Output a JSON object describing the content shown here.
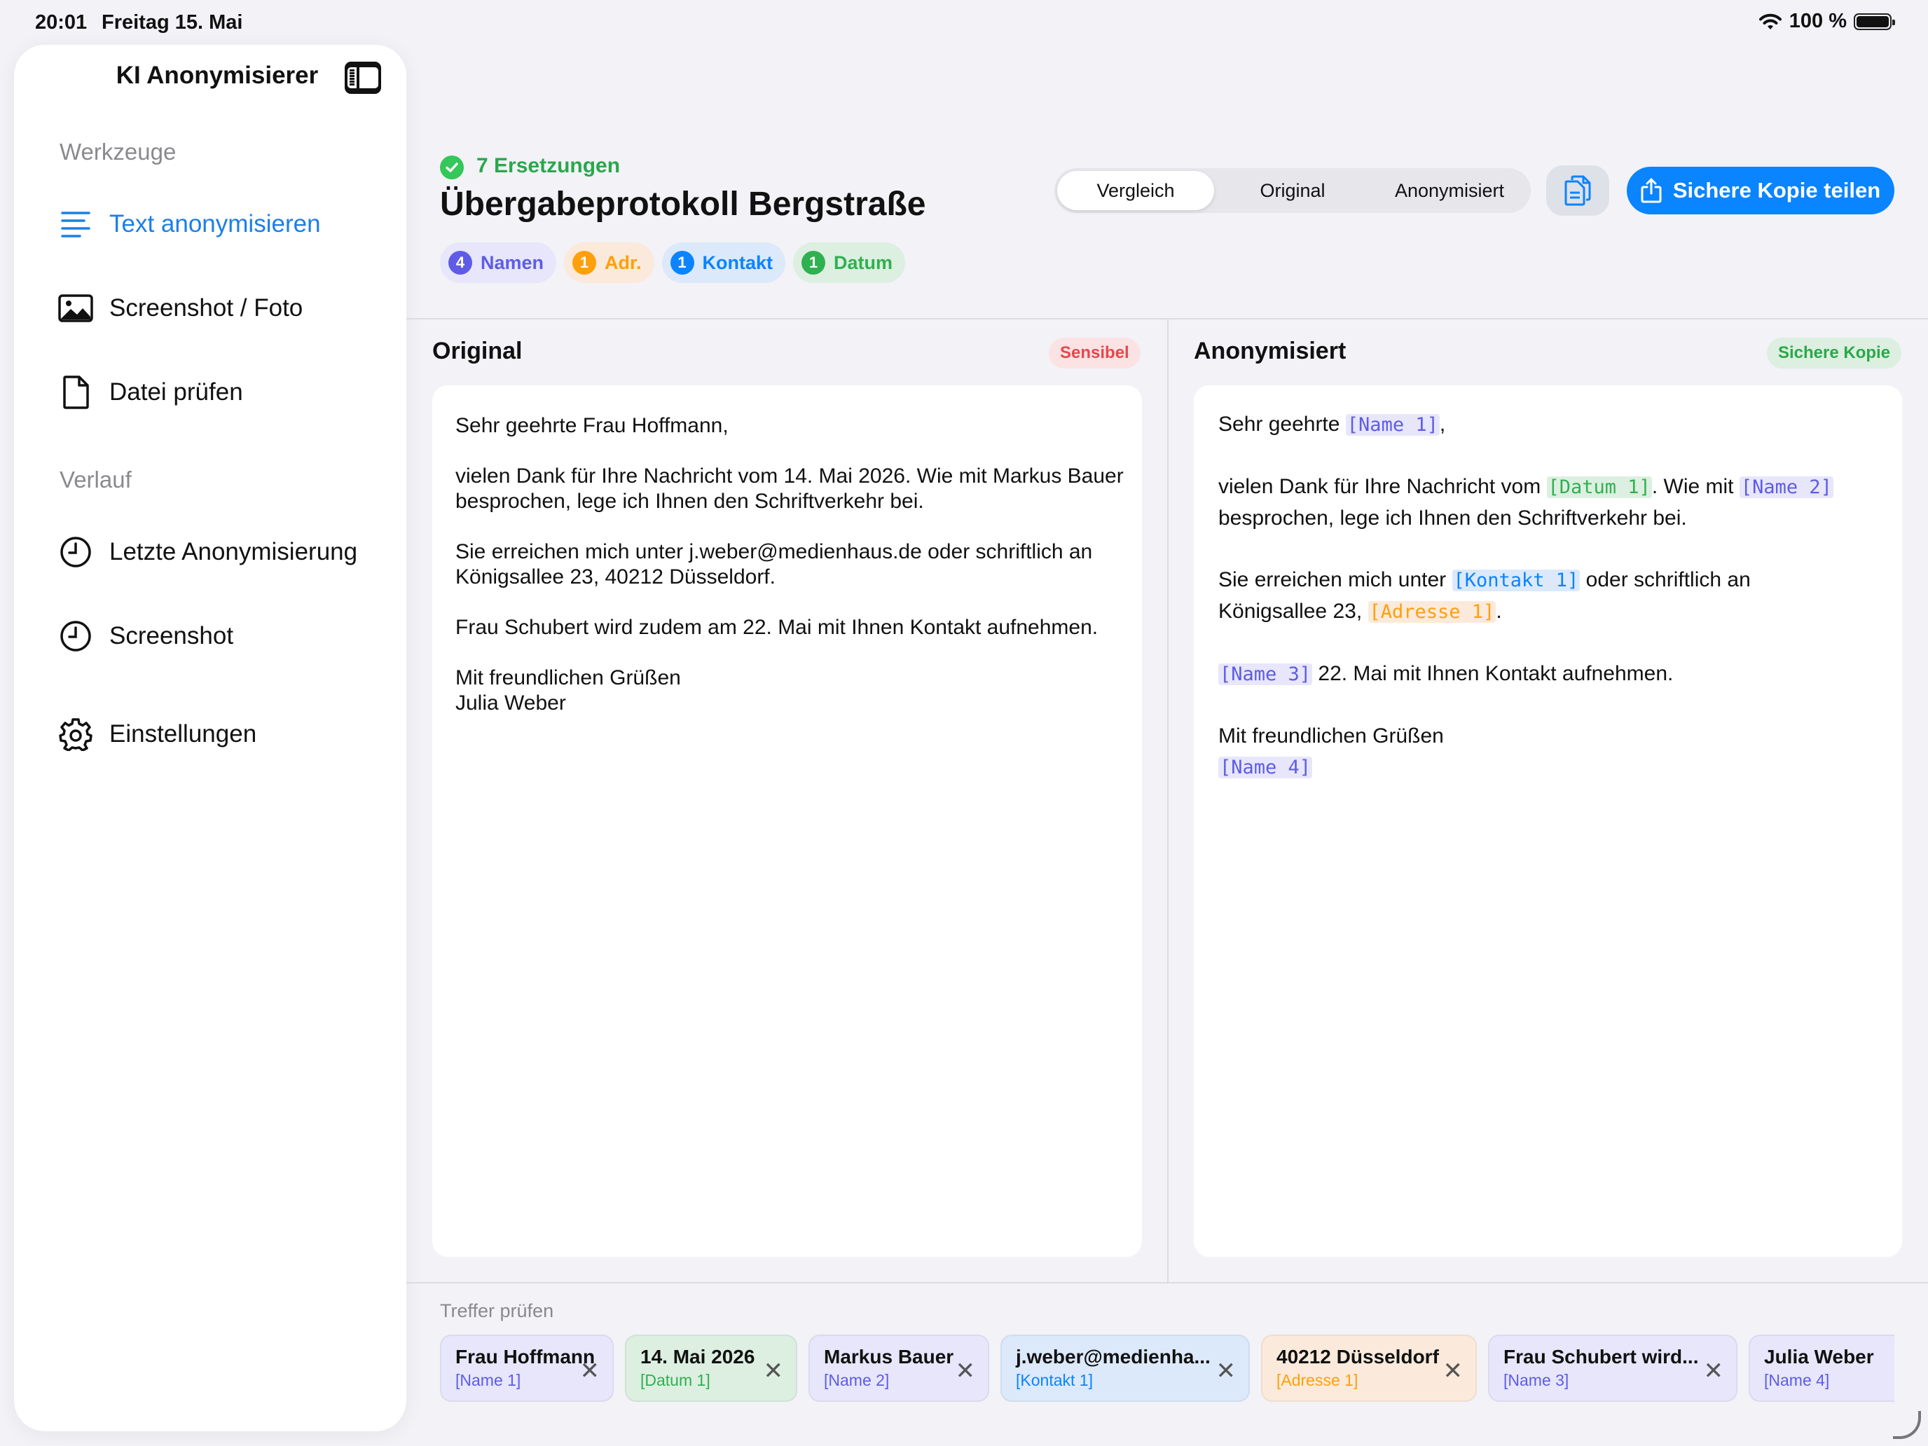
{
  "status": {
    "time": "20:01",
    "date": "Freitag 15. Mai",
    "battery": "100 %"
  },
  "sidebar": {
    "title": "KI Anonymisierer",
    "section_tools": "Werkzeuge",
    "tools": [
      {
        "label": "Text anonymisieren",
        "icon": "text-lines-icon"
      },
      {
        "label": "Screenshot / Foto",
        "icon": "photo-icon"
      },
      {
        "label": "Datei prüfen",
        "icon": "document-icon"
      }
    ],
    "section_history": "Verlauf",
    "history": [
      {
        "label": "Letzte Anonymisierung",
        "icon": "clock-icon"
      },
      {
        "label": "Screenshot",
        "icon": "clock-icon"
      }
    ],
    "settings": "Einstellungen"
  },
  "header": {
    "count": "7 Ersetzungen",
    "title": "Übergabeprotokoll Bergstraße",
    "chips": [
      {
        "count": "4",
        "label": "Namen",
        "color": "#5e5ce6"
      },
      {
        "count": "1",
        "label": "Adr.",
        "color": "#ff9f0a"
      },
      {
        "count": "1",
        "label": "Kontakt",
        "color": "#0a84ff"
      },
      {
        "count": "1",
        "label": "Datum",
        "color": "#30b050"
      }
    ],
    "segments": [
      "Vergleich",
      "Original",
      "Anonymisiert"
    ],
    "share": "Sichere Kopie teilen"
  },
  "original": {
    "title": "Original",
    "badge": "Sensibel",
    "paragraphs": [
      "Sehr geehrte Frau Hoffmann,",
      "vielen Dank für Ihre Nachricht vom 14. Mai 2026. Wie mit Markus Bauer besprochen, lege ich Ihnen den Schriftverkehr bei.",
      "Sie erreichen mich unter j.weber@medienhaus.de oder schriftlich an Königsallee 23, 40212 Düsseldorf.",
      "Frau Schubert wird zudem am 22. Mai mit Ihnen Kontakt aufnehmen.",
      "Mit freundlichen Grüßen",
      "Julia Weber"
    ]
  },
  "anonymized": {
    "title": "Anonymisiert",
    "badge": "Sichere Kopie",
    "p1a": "Sehr geehrte ",
    "name1": "[Name 1]",
    "p1b": ",",
    "p2a": "vielen Dank für Ihre Nachricht vom ",
    "datum1": "[Datum 1]",
    "p2b": ". Wie mit ",
    "name2": "[Name 2]",
    "p2c": "besprochen, lege ich Ihnen den Schriftverkehr bei.",
    "p3a": "Sie erreichen mich unter ",
    "kontakt1": "[Kontakt 1]",
    "p3b": " oder schriftlich an",
    "p3c": "Königsallee 23, ",
    "adresse1": "[Adresse 1]",
    "p3d": ".",
    "name3": "[Name 3]",
    "p4": " 22. Mai mit Ihnen Kontakt aufnehmen.",
    "p5": "Mit freundlichen Grüßen",
    "name4": "[Name 4]"
  },
  "treffer": {
    "label": "Treffer prüfen",
    "items": [
      {
        "value": "Frau Hoffmann",
        "tag": "[Name 1]",
        "kind": "name"
      },
      {
        "value": "14. Mai 2026",
        "tag": "[Datum 1]",
        "kind": "datum"
      },
      {
        "value": "Markus Bauer",
        "tag": "[Name 2]",
        "kind": "name"
      },
      {
        "value": "j.weber@medienha...",
        "tag": "[Kontakt 1]",
        "kind": "kontakt"
      },
      {
        "value": "40212 Düsseldorf",
        "tag": "[Adresse 1]",
        "kind": "adresse"
      },
      {
        "value": "Frau Schubert wird...",
        "tag": "[Name 3]",
        "kind": "name"
      },
      {
        "value": "Julia Weber",
        "tag": "[Name 4]",
        "kind": "name"
      }
    ]
  },
  "colors": {
    "accent": "#0a84ff",
    "name": "#5e5ce6",
    "datum": "#30b050",
    "kontakt": "#0a84ff",
    "adresse": "#ff9f0a",
    "sensitive": "#e5484d",
    "safe": "#2aa84a"
  }
}
